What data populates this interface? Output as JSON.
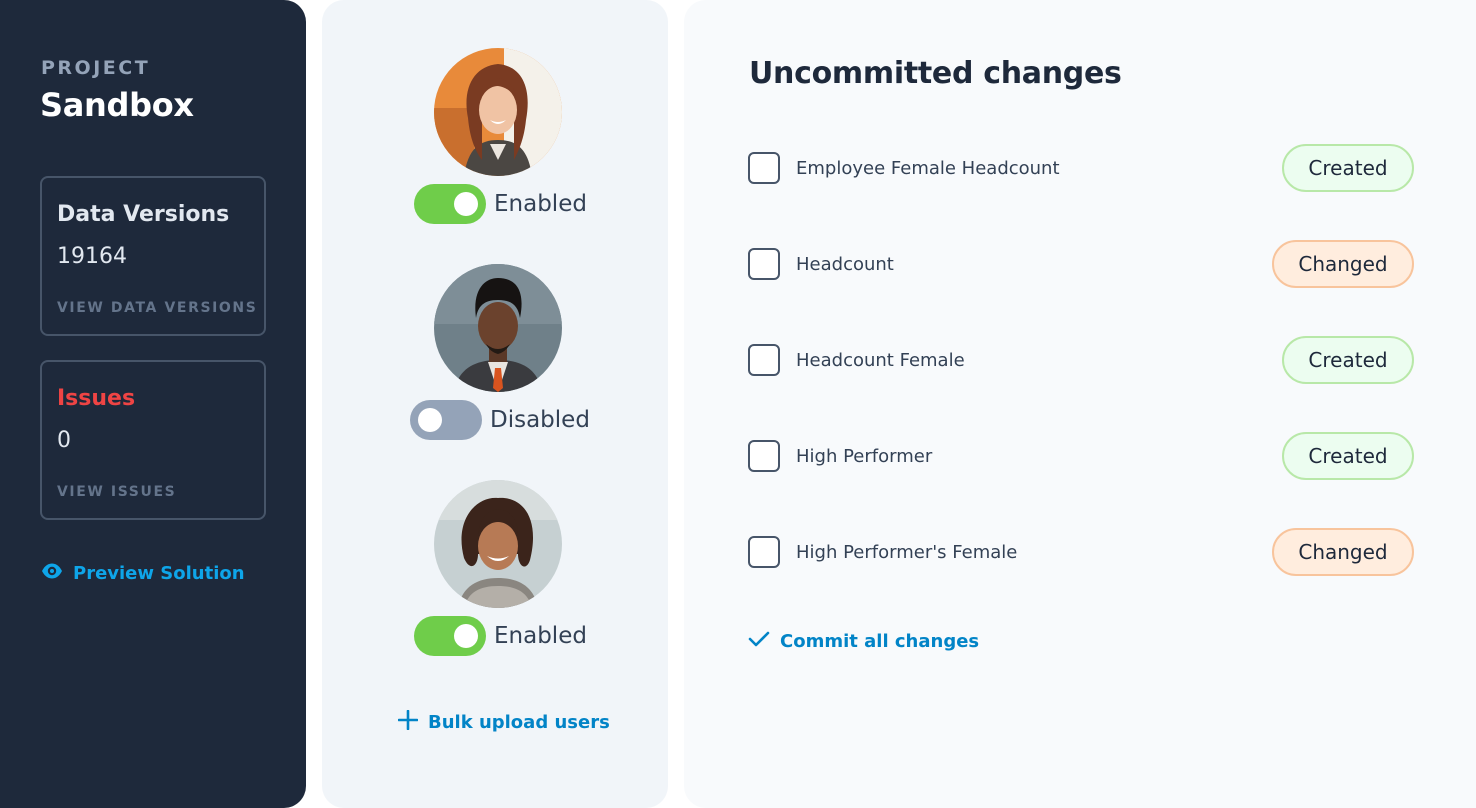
{
  "project": {
    "kicker": "PROJECT",
    "name": "Sandbox"
  },
  "data_versions": {
    "title": "Data Versions",
    "value": "19164",
    "link": "VIEW DATA VERSIONS"
  },
  "issues": {
    "title": "Issues",
    "value": "0",
    "link": "VIEW ISSUES"
  },
  "preview": {
    "label": "Preview Solution",
    "icon": "eye-icon"
  },
  "users": [
    {
      "status": "Enabled",
      "enabled": true
    },
    {
      "status": "Disabled",
      "enabled": false
    },
    {
      "status": "Enabled",
      "enabled": true
    }
  ],
  "bulk_upload": {
    "label": "Bulk upload users",
    "icon": "plus-icon"
  },
  "changes": {
    "title": "Uncommitted changes",
    "items": [
      {
        "label": "Employee Female Headcount",
        "status": "Created"
      },
      {
        "label": "Headcount",
        "status": "Changed"
      },
      {
        "label": "Headcount Female",
        "status": "Created"
      },
      {
        "label": "High Performer",
        "status": "Created"
      },
      {
        "label": "High Performer's Female",
        "status": "Changed"
      }
    ],
    "commit_label": "Commit all changes"
  },
  "colors": {
    "sidebar_bg": "#1e293b",
    "accent": "#0284c7",
    "toggle_on": "#6fcd4a",
    "toggle_off": "#94a3b8",
    "danger": "#ef4444",
    "created_bg": "#ecfdf0",
    "changed_bg": "#ffedde"
  }
}
